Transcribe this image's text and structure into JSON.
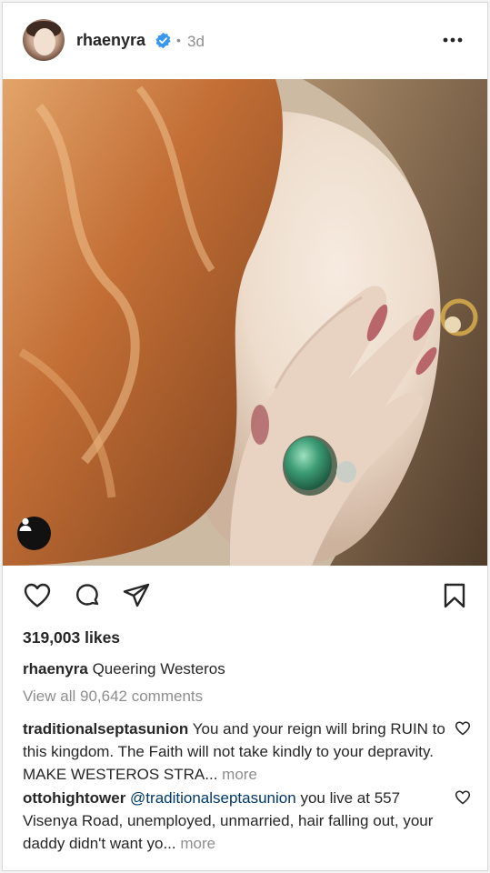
{
  "post": {
    "username": "rhaenyra",
    "separator": "•",
    "time": "3d",
    "verified_color": "#3897f0",
    "likes": "319,003 likes",
    "caption_author": "rhaenyra",
    "caption_text": "Queering Westeros",
    "view_all": "View all 90,642 comments"
  },
  "comments": [
    {
      "author": "traditionalseptasunion",
      "text": "You and your reign will bring RUIN to this kingdom. The Faith will not take kindly to your depravity. MAKE WESTEROS STRA...",
      "more": "more"
    },
    {
      "author": "ottohightower",
      "mention": "@traditionalseptasunion",
      "text": "you live at 557 Visenya Road, unemployed, unmarried, hair falling out, your daddy didn't want yo...",
      "more": "more"
    }
  ],
  "icons": {
    "header": [
      "avatar",
      "verified-icon",
      "more-icon"
    ],
    "photo": [
      "user-tag-icon"
    ],
    "actions": [
      "heart-icon",
      "comment-icon",
      "share-icon",
      "save-icon"
    ]
  }
}
